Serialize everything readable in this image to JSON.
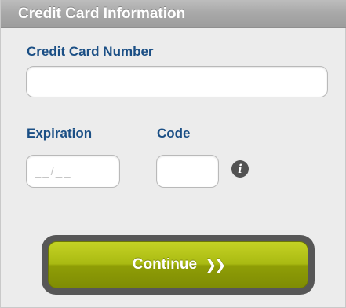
{
  "header": {
    "title": "Credit Card Information"
  },
  "form": {
    "card_number_label": "Credit Card Number",
    "card_number_value": "",
    "expiration_label": "Expiration",
    "expiration_placeholder": "__/__",
    "expiration_value": "",
    "code_label": "Code",
    "code_value": "",
    "info_icon_glyph": "i",
    "info_icon_name": "info-icon"
  },
  "actions": {
    "continue_label": "Continue",
    "continue_icon_glyph": "❯❯",
    "continue_icon_name": "double-chevron-right-icon"
  },
  "colors": {
    "label": "#1b4f85",
    "header_bg": "#a9a9a9",
    "button_green": "#a9ba12",
    "button_frame": "#575757"
  }
}
